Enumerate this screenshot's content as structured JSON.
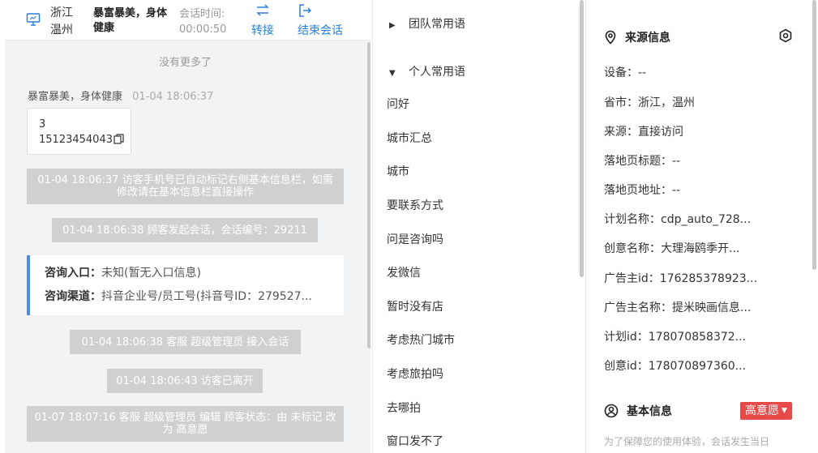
{
  "header": {
    "location": "浙江\n温州",
    "visitor_name": "暴富暴美，身体健康",
    "session_time_label": "会话时间:",
    "session_time": "00:00:50",
    "transfer_label": "转接",
    "end_label": "结束会话"
  },
  "chat": {
    "no_more": "没有更多了",
    "msg_sender": "暴富暴美，身体健康",
    "msg_time": "01-04 18:06:37",
    "msg_line1": "3",
    "msg_line2": "15123454043",
    "sys1": "01-04 18:06:37 访客手机号已自动标记右侧基本信息栏，如需修改请在基本信息栏直接操作",
    "sys2": "01-04 18:06:38 顾客发起会话，会话编号：29211",
    "card_entry_key": "咨询入口：",
    "card_entry_val": "未知(暂无入口信息)",
    "card_channel_key": "咨询渠道：",
    "card_channel_val": "抖音企业号/员工号(抖音号ID：279527...",
    "sys3": "01-04 18:06:38 客服 超级管理员 接入会话",
    "sys4": "01-04 18:06:43 访客已离开",
    "sys5": "01-07 18:07:16 客服 超级管理员 编辑 顾客状态：由 未标记 改为 高意愿"
  },
  "quick": {
    "team_group": "团队常用语",
    "personal_group": "个人常用语",
    "items": [
      "问好",
      "城市汇总",
      "城市",
      "要联系方式",
      "问是咨询吗",
      "发微信",
      "暂时没有店",
      "考虑热门城市",
      "考虑旅拍吗",
      "去哪拍",
      "窗口发不了"
    ]
  },
  "side": {
    "source_title": "来源信息",
    "fields": [
      "设备：--",
      "省市：浙江，温州",
      "来源：直接访问",
      "落地页标题：--",
      "落地页地址：--",
      "计划名称：cdp_auto_728...",
      "创意名称：大理海鸥季开...",
      "广告主id：176285378923...",
      "广告主名称：提米映画信息...",
      "计划id：178070858372...",
      "创意id：178070897360..."
    ],
    "basic_title": "基本信息",
    "intent_label": "高意愿",
    "notice": "为了保障您的使用体验，会话发生当日"
  },
  "colors": {
    "accent": "#2b7fd9",
    "badge": "#e84a4a",
    "system_bubble": "#d0d0d0",
    "card_border": "#4a90e2"
  }
}
